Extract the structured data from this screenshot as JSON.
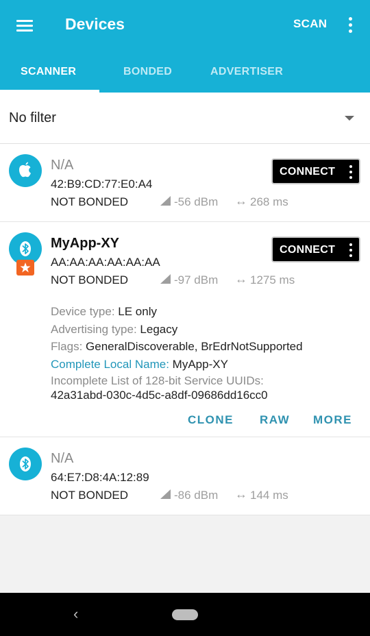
{
  "appbar": {
    "title": "Devices",
    "scan_label": "SCAN",
    "bg_color": "#17b1d6",
    "tabs": [
      {
        "label": "SCANNER",
        "active": true
      },
      {
        "label": "BONDED",
        "active": false
      },
      {
        "label": "ADVERTISER",
        "active": false
      }
    ]
  },
  "filter": {
    "value": "No filter"
  },
  "devices": [
    {
      "name": "N/A",
      "address": "42:B9:CD:77:E0:A4",
      "bond_state": "NOT BONDED",
      "rssi": "-56 dBm",
      "interval": "268 ms",
      "icon": "apple-icon",
      "connect_label": "CONNECT"
    },
    {
      "name": "MyApp-XY",
      "address": "AA:AA:AA:AA:AA:AA",
      "bond_state": "NOT BONDED",
      "rssi": "-97 dBm",
      "interval": "1275 ms",
      "icon": "bluetooth-icon",
      "connect_label": "CONNECT",
      "details": {
        "device_type_label": "Device type:",
        "device_type": "LE only",
        "advertising_type_label": "Advertising type:",
        "advertising_type": "Legacy",
        "flags_label": "Flags:",
        "flags": "GeneralDiscoverable, BrEdrNotSupported",
        "local_name_label": "Complete Local Name:",
        "local_name": "MyApp-XY",
        "uuids_label": "Incomplete List of 128-bit Service UUIDs:",
        "uuids": "42a31abd-030c-4d5c-a8df-09686dd16cc0"
      },
      "actions": [
        "CLONE",
        "RAW",
        "MORE"
      ]
    },
    {
      "name": "N/A",
      "address": "64:E7:D8:4A:12:89",
      "bond_state": "NOT BONDED",
      "rssi": "-86 dBm",
      "interval": "144 ms",
      "icon": "bluetooth-icon",
      "connect_label": ""
    }
  ]
}
